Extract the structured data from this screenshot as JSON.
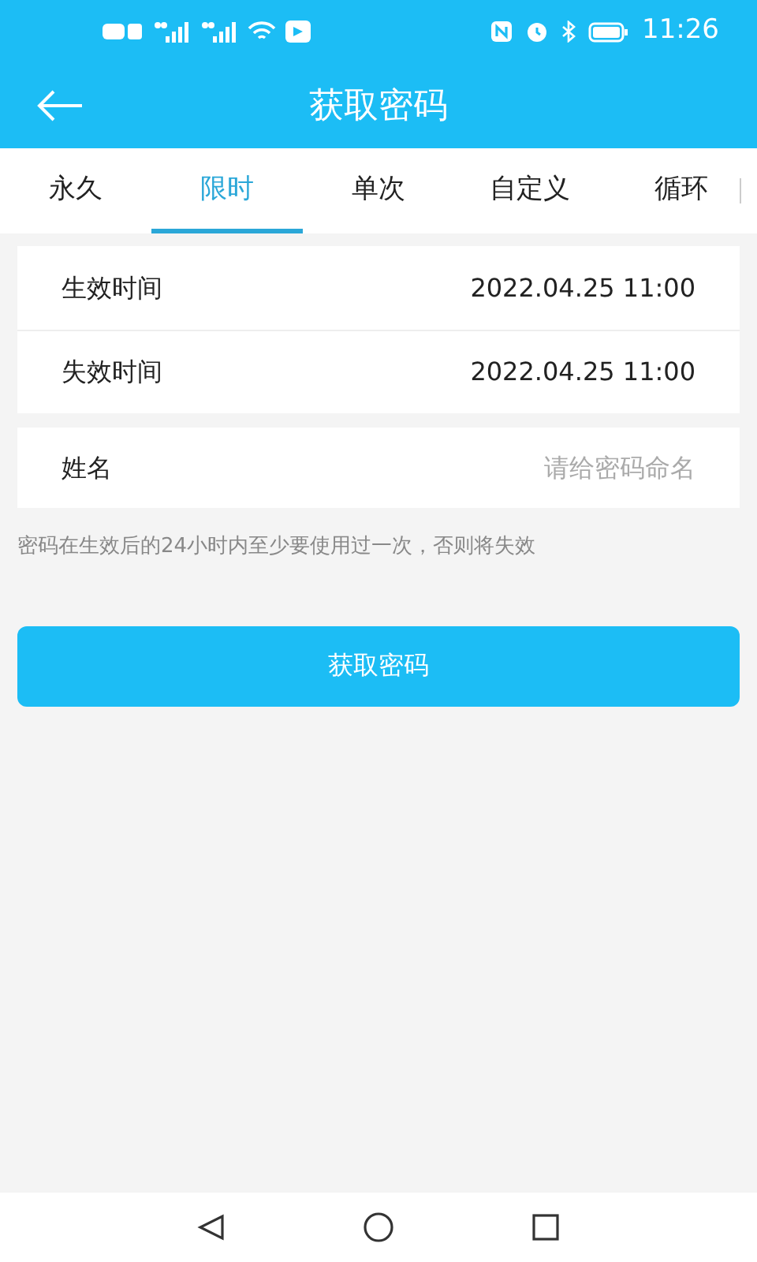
{
  "status_bar": {
    "time": "11:26"
  },
  "header": {
    "title": "获取密码"
  },
  "tabs": [
    {
      "label": "永久",
      "selected": false
    },
    {
      "label": "限时",
      "selected": true
    },
    {
      "label": "单次",
      "selected": false
    },
    {
      "label": "自定义",
      "selected": false
    },
    {
      "label": "循环",
      "selected": false
    }
  ],
  "time_rows": [
    {
      "label": "生效时间",
      "value": "2022.04.25 11:00"
    },
    {
      "label": "失效时间",
      "value": "2022.04.25 11:00"
    }
  ],
  "name_field": {
    "label": "姓名",
    "placeholder": "请给密码命名"
  },
  "note": "密码在生效后的24小时内至少要使用过一次，否则将失效",
  "submit_button": "获取密码"
}
